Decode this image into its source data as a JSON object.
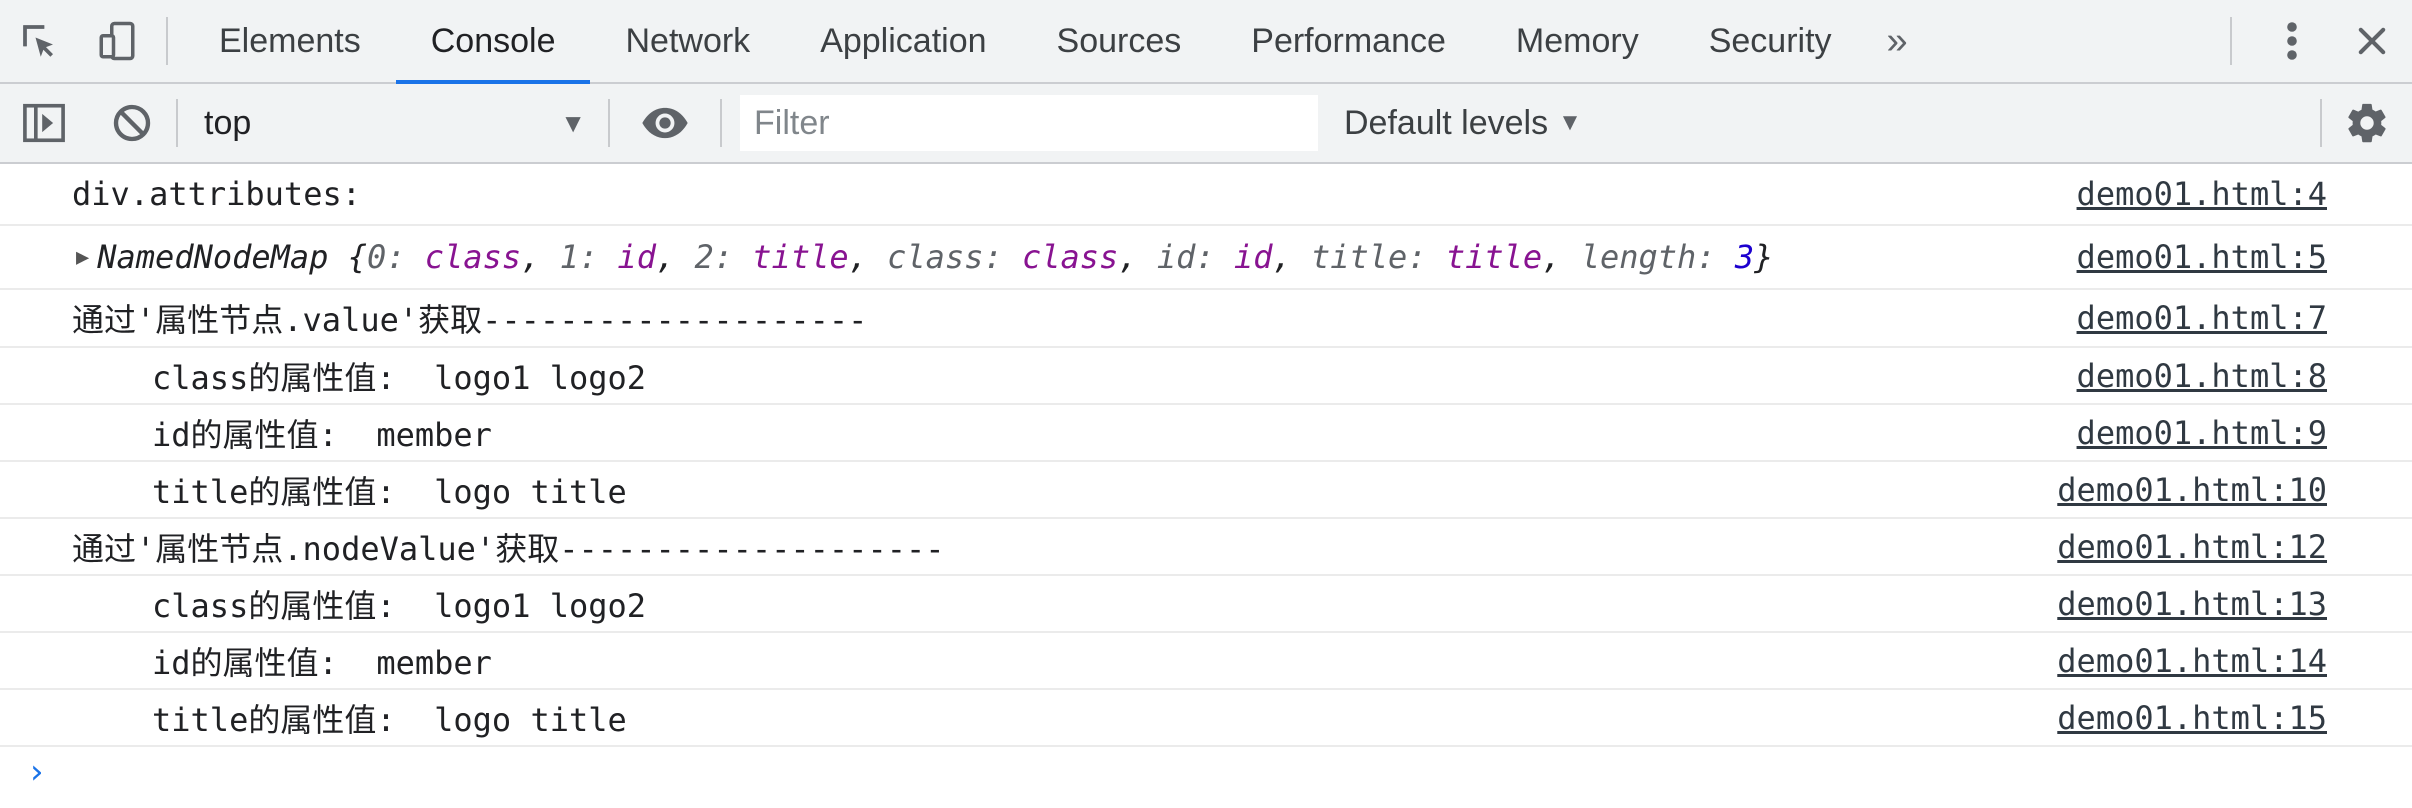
{
  "tabs": [
    {
      "label": "Elements"
    },
    {
      "label": "Console",
      "active": true
    },
    {
      "label": "Network"
    },
    {
      "label": "Application"
    },
    {
      "label": "Sources"
    },
    {
      "label": "Performance"
    },
    {
      "label": "Memory"
    },
    {
      "label": "Security"
    }
  ],
  "tab_more": "»",
  "toolbar": {
    "context": "top",
    "filter_placeholder": "Filter",
    "levels": "Default levels"
  },
  "namednodemap": {
    "name": "NamedNodeMap",
    "entries": [
      {
        "key": "0",
        "value": "class"
      },
      {
        "key": "1",
        "value": "id"
      },
      {
        "key": "2",
        "value": "title"
      },
      {
        "key": "class",
        "value": "class"
      },
      {
        "key": "id",
        "value": "id"
      },
      {
        "key": "title",
        "value": "title"
      }
    ],
    "length_key": "length",
    "length_value": "3"
  },
  "messages": [
    {
      "text": "div.attributes:",
      "src": "demo01.html:4",
      "indent": false
    },
    {
      "type": "namednodemap",
      "src": "demo01.html:5"
    },
    {
      "text": "通过'属性节点.value'获取--------------------",
      "src": "demo01.html:7",
      "indent": false
    },
    {
      "text": "class的属性值:  logo1 logo2",
      "src": "demo01.html:8",
      "indent": true
    },
    {
      "text": "id的属性值:  member",
      "src": "demo01.html:9",
      "indent": true
    },
    {
      "text": "title的属性值:  logo title",
      "src": "demo01.html:10",
      "indent": true
    },
    {
      "text": "通过'属性节点.nodeValue'获取--------------------",
      "src": "demo01.html:12",
      "indent": false
    },
    {
      "text": "class的属性值:  logo1 logo2",
      "src": "demo01.html:13",
      "indent": true
    },
    {
      "text": "id的属性值:  member",
      "src": "demo01.html:14",
      "indent": true
    },
    {
      "text": "title的属性值:  logo title",
      "src": "demo01.html:15",
      "indent": true
    }
  ],
  "prompt": "›",
  "colors": {
    "accent": "#1a73e8",
    "property_value": "#881391",
    "number": "#1c00cf",
    "toolbar_bg": "#f1f3f4"
  },
  "icons": [
    "inspect-icon",
    "device-toggle-icon",
    "more-vertical-icon",
    "close-icon",
    "sidebar-toggle-icon",
    "clear-console-icon",
    "eye-icon",
    "gear-icon"
  ]
}
